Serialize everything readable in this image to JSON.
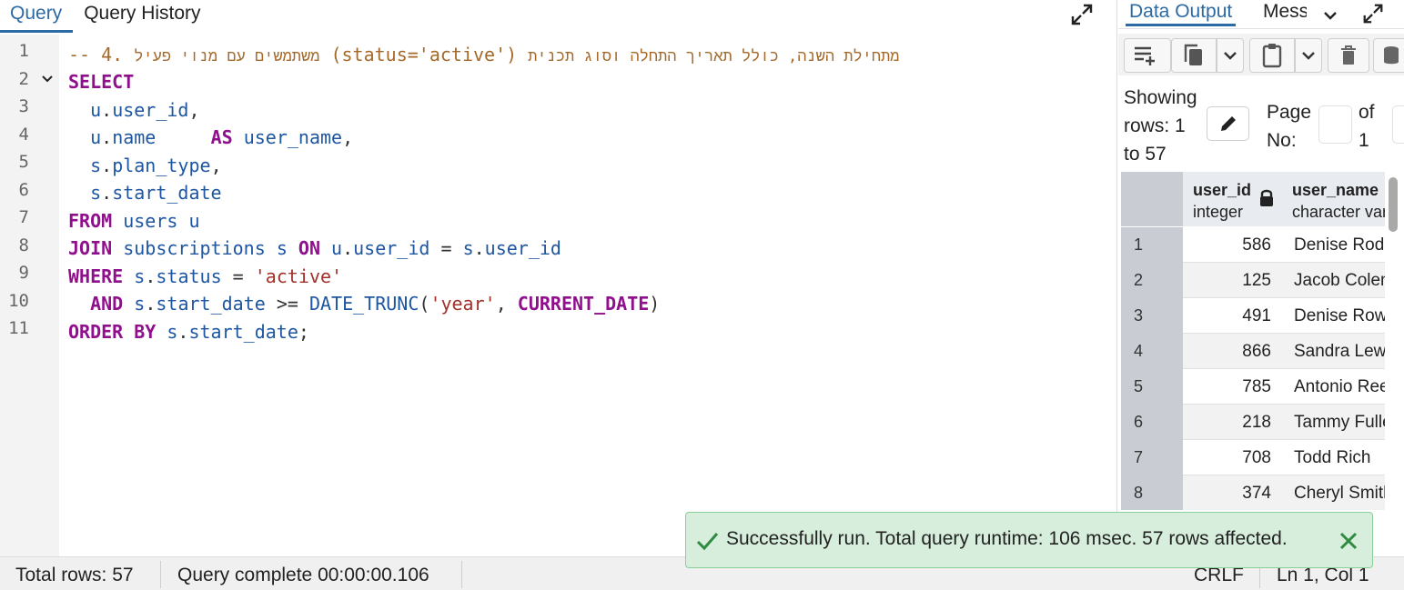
{
  "editor": {
    "tabs": [
      {
        "label": "Query"
      },
      {
        "label": "Query History"
      }
    ],
    "lines": [
      {
        "num": "1"
      },
      {
        "num": "2"
      },
      {
        "num": "3"
      },
      {
        "num": "4"
      },
      {
        "num": "5"
      },
      {
        "num": "6"
      },
      {
        "num": "7"
      },
      {
        "num": "8"
      },
      {
        "num": "9"
      },
      {
        "num": "10"
      },
      {
        "num": "11"
      }
    ],
    "code": {
      "l1_dash": "-- 4.",
      "l1_heb1": "משתמשים עם מנוי פעיל",
      "l1_paren": "(status='active')",
      "l1_heb2": "מתחילת השנה, כולל תאריך התחלה וסוג תכנית",
      "select": "SELECT",
      "u": "u",
      "user_id": "user_id",
      "name": "name",
      "as": "AS",
      "user_name": "user_name",
      "s": "s",
      "plan_type": "plan_type",
      "start_date": "start_date",
      "from": "FROM",
      "users": "users",
      "join": "JOIN",
      "subscriptions": "subscriptions",
      "on": "ON",
      "where": "WHERE",
      "status": "status",
      "active_str": "'active'",
      "and": "AND",
      "date_trunc": "DATE_TRUNC",
      "year_str": "'year'",
      "current_date": "CURRENT_DATE",
      "order_by": "ORDER BY"
    }
  },
  "results": {
    "tabs": [
      {
        "label": "Data Output"
      },
      {
        "label": "Messages"
      }
    ],
    "paging": {
      "showing_l1": "Showing",
      "showing_l2": "rows: 1",
      "showing_l3": "to 57",
      "page_l1": "Page",
      "page_l2": "No:",
      "of_l1": "of",
      "of_l2": "1"
    },
    "columns": [
      {
        "name": "user_id",
        "type": "integer"
      },
      {
        "name": "user_name",
        "type": "character varying"
      }
    ],
    "rows": [
      {
        "n": "1",
        "user_id": "586",
        "user_name": "Denise Rodriguez"
      },
      {
        "n": "2",
        "user_id": "125",
        "user_name": "Jacob Coleman"
      },
      {
        "n": "3",
        "user_id": "491",
        "user_name": "Denise Rowe"
      },
      {
        "n": "4",
        "user_id": "866",
        "user_name": "Sandra Lewis"
      },
      {
        "n": "5",
        "user_id": "785",
        "user_name": "Antonio Reed"
      },
      {
        "n": "6",
        "user_id": "218",
        "user_name": "Tammy Fuller"
      },
      {
        "n": "7",
        "user_id": "708",
        "user_name": "Todd Rich"
      },
      {
        "n": "8",
        "user_id": "374",
        "user_name": "Cheryl Smith"
      }
    ]
  },
  "status": {
    "total_rows": "Total rows: 57",
    "query_complete": "Query complete 00:00:00.106",
    "eol": "CRLF",
    "cursor": "Ln 1, Col 1"
  },
  "toast": {
    "message": "Successfully run. Total query runtime: 106 msec. 57 rows affected."
  },
  "colors": {
    "accent": "#2c6aa5",
    "keyword": "#8f0f8d",
    "identifier": "#1e56a0",
    "string": "#a3312a",
    "comment": "#a56a2a",
    "success_bg": "#d6eedb"
  }
}
